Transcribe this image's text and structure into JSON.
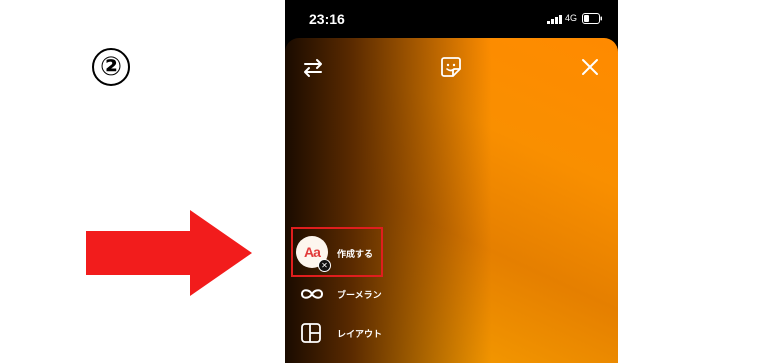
{
  "step": {
    "marker": "②"
  },
  "status_bar": {
    "time": "23:16",
    "network": "4G"
  },
  "menu": {
    "create_avatar": "Aa",
    "create_label": "作成する",
    "boomerang_label": "ブーメラン",
    "layout_label": "レイアウト"
  },
  "colors": {
    "arrow": "#f21c1c",
    "highlight_box": "#e01e1e",
    "gradient_orange": "#ff8a00",
    "gradient_dark": "#1a0b00"
  },
  "icons": [
    "swap-icon",
    "sticker-icon",
    "close-icon",
    "boomerang-icon",
    "layout-icon",
    "signal-icon",
    "battery-icon"
  ]
}
